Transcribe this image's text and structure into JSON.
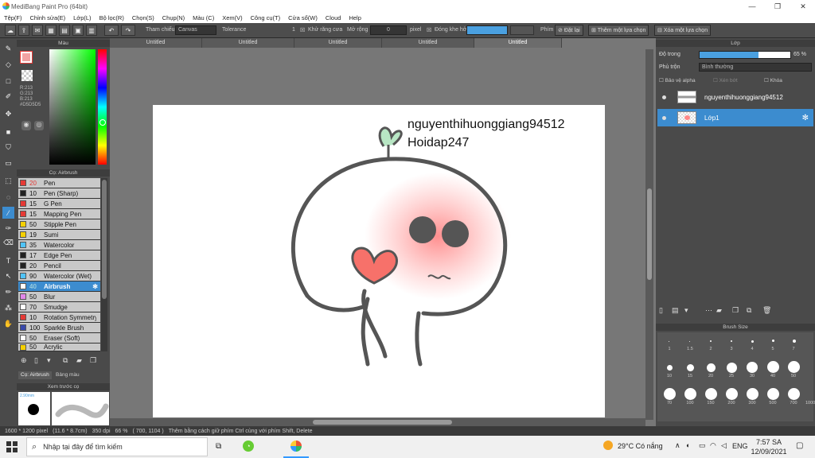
{
  "window": {
    "title": "MediBang Paint Pro (64bit)",
    "minimize": "—",
    "restore": "❐",
    "close": "✕"
  },
  "menu": [
    "Tệp(F)",
    "Chỉnh sửa(E)",
    "Lớp(L)",
    "Bộ lọc(R)",
    "Chọn(S)",
    "Chụp(N)",
    "Màu (C)",
    "Xem(V)",
    "Công cụ(T)",
    "Cửa sổ(W)",
    "Cloud",
    "Help"
  ],
  "toolbar": {
    "ref_label": "Tham chiếu",
    "ref_value": "Canvas",
    "tolerance_label": "Tolerance",
    "tolerance_value": "1",
    "antialias_label": "Khử răng cưa",
    "expand_label": "Mở rộng",
    "expand_value": "0",
    "expand_unit": "pixel",
    "close_gap_label": "Đóng khe hở",
    "grab_label": "Phím",
    "reset_label": "Đặt lại",
    "add_selection_label": "Thêm một lựa chọn",
    "remove_selection_label": "Xóa một lựa chọn"
  },
  "color_panel": {
    "title": "Màu",
    "rgb_r": "R:213",
    "rgb_g": "G:213",
    "rgb_b": "B:213",
    "hex": "#D5D5D5"
  },
  "brush_panel": {
    "title": "Cọ: Airbrush",
    "brushes": [
      {
        "size": "20",
        "name": "Pen",
        "color": "#e53935"
      },
      {
        "size": "10",
        "name": "Pen (Sharp)",
        "color": "#222222"
      },
      {
        "size": "15",
        "name": "G Pen",
        "color": "#e53935"
      },
      {
        "size": "15",
        "name": "Mapping Pen",
        "color": "#e53935"
      },
      {
        "size": "50",
        "name": "Stipple Pen",
        "color": "#f5d000"
      },
      {
        "size": "19",
        "name": "Sumi",
        "color": "#f5d000"
      },
      {
        "size": "35",
        "name": "Watercolor",
        "color": "#4fc3f7"
      },
      {
        "size": "17",
        "name": "Edge Pen",
        "color": "#222222"
      },
      {
        "size": "20",
        "name": "Pencil",
        "color": "#222222"
      },
      {
        "size": "90",
        "name": "Watercolor (Wet)",
        "color": "#4fc3f7"
      },
      {
        "size": "40",
        "name": "Airbrush",
        "color": "#ffffff"
      },
      {
        "size": "50",
        "name": "Blur",
        "color": "#e088e8"
      },
      {
        "size": "70",
        "name": "Smudge",
        "color": "#ffffff"
      },
      {
        "size": "10",
        "name": "Rotation Symmetry",
        "color": "#e53935"
      },
      {
        "size": "100",
        "name": "Sparkle Brush",
        "color": "#3949ab"
      },
      {
        "size": "50",
        "name": "Eraser (Soft)",
        "color": "#ffffff"
      },
      {
        "size": "50",
        "name": "Acrylic",
        "color": "#f5d000"
      }
    ],
    "tab1": "Cọ: Airbrush",
    "tab2": "Bảng màu"
  },
  "preview": {
    "title": "Xem trước cọ",
    "size": "2.90mm"
  },
  "tabs": [
    "Untitled",
    "Untitled",
    "Untitled",
    "Untitled",
    "Untitled"
  ],
  "canvas_text": {
    "line1": "nguyenthihuonggiang94512",
    "line2": "Hoidap247"
  },
  "layer_panel": {
    "title": "Lớp",
    "opacity_label": "Độ trong",
    "opacity_value": "65 %",
    "opacity": 0.65,
    "blend_label": "Phủ trộn",
    "blend_value": "Bình thường",
    "protect_alpha": "Bảo vệ alpha",
    "clipping": "Xén bớt",
    "lock": "Khóa",
    "layers": [
      {
        "name": "nguyenthihuonggiang94512"
      },
      {
        "name": "Lớp1"
      }
    ]
  },
  "brush_size_panel": {
    "title": "Brush Size",
    "sizes": [
      "1",
      "1.5",
      "2",
      "3",
      "4",
      "5",
      "7",
      "10",
      "15",
      "20",
      "25",
      "30",
      "40",
      "50",
      "70",
      "100",
      "150",
      "200",
      "300",
      "500",
      "700",
      "1000"
    ]
  },
  "status": {
    "dimensions": "1600 * 1200 pixel",
    "physical": "(11.6 * 8.7cm)",
    "dpi": "350 dpi",
    "zoom": "66 %",
    "coords": "( 700, 1104 )",
    "hint": "Thêm bằng cách giữ phím Ctrl cùng với phím Shift, Delete"
  },
  "taskbar": {
    "search_placeholder": "Nhập tại đây để tìm kiếm",
    "weather": "29°C Có nắng",
    "lang": "ENG",
    "time": "7:57 SA",
    "date": "12/09/2021"
  }
}
